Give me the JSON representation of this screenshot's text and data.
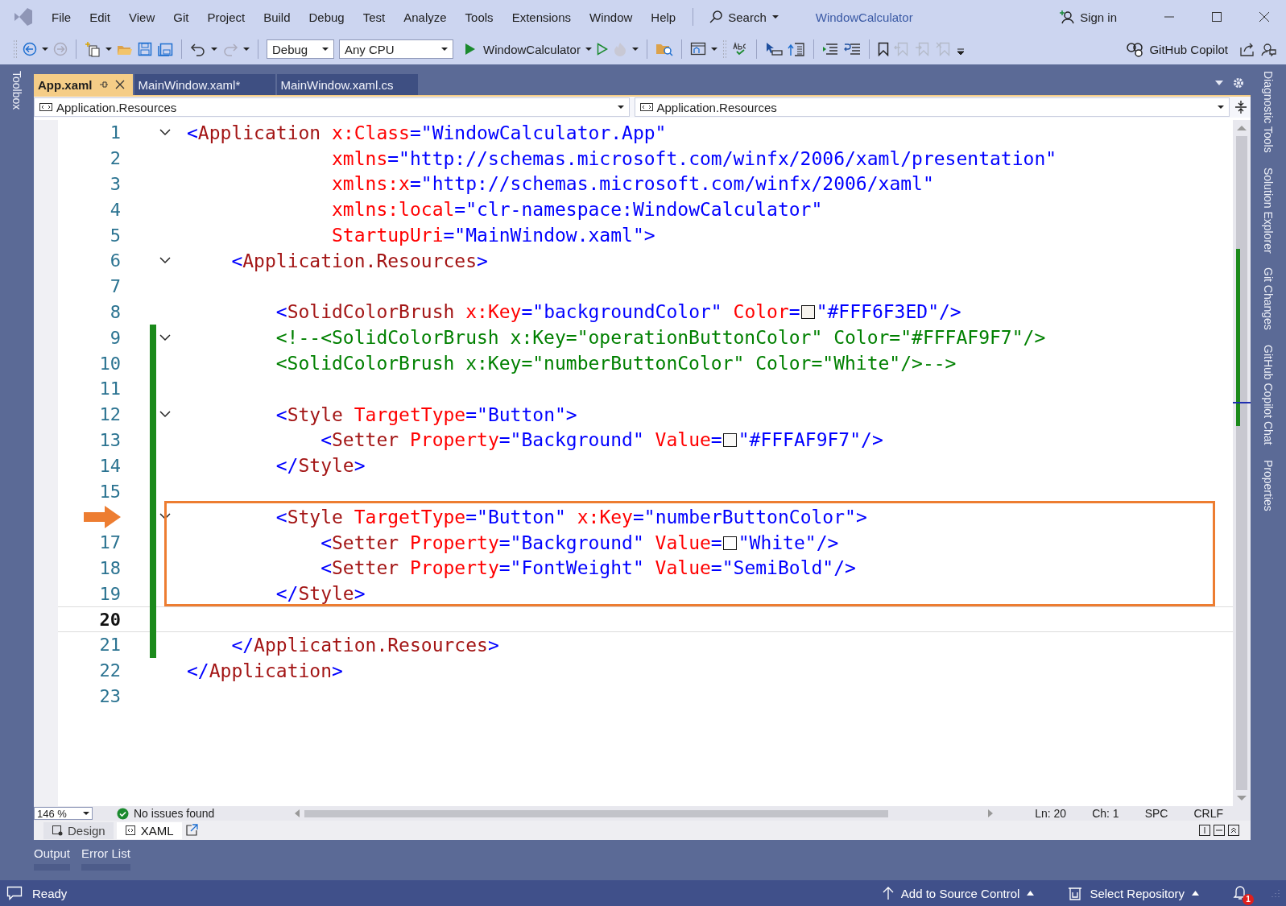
{
  "window": {
    "title": "WindowCalculator"
  },
  "menu": [
    "File",
    "Edit",
    "View",
    "Git",
    "Project",
    "Build",
    "Debug",
    "Test",
    "Analyze",
    "Tools",
    "Extensions",
    "Window",
    "Help"
  ],
  "search": {
    "label": "Search"
  },
  "account": {
    "label": "Sign in"
  },
  "toolbar": {
    "configuration": "Debug",
    "platform": "Any CPU",
    "start_target": "WindowCalculator",
    "copilot": "GitHub Copilot"
  },
  "left_rail": [
    "Toolbox"
  ],
  "right_rail": [
    "Diagnostic Tools",
    "Solution Explorer",
    "Git Changes",
    "GitHub Copilot Chat",
    "Properties"
  ],
  "tabs": [
    {
      "label": "App.xaml",
      "selected": true
    },
    {
      "label": "MainWindow.xaml*",
      "selected": false
    },
    {
      "label": "MainWindow.xaml.cs",
      "selected": false
    }
  ],
  "nav_bar": [
    "Application.Resources",
    "Application.Resources"
  ],
  "code": {
    "lines": [
      {
        "kind": "line",
        "number": "1",
        "fold": true,
        "changed": false,
        "current": false,
        "tokens": [
          {
            "kind": "punct",
            "text": "<"
          },
          {
            "kind": "element",
            "text": "Application"
          },
          {
            "kind": "attr",
            "text": " x:Class"
          },
          {
            "kind": "punct",
            "text": "="
          },
          {
            "kind": "value",
            "text": "\"WindowCalculator.App\""
          }
        ]
      },
      {
        "kind": "line",
        "number": "2",
        "fold": false,
        "changed": false,
        "current": false,
        "tokens": [
          {
            "kind": "attr",
            "text": "             xmlns"
          },
          {
            "kind": "punct",
            "text": "="
          },
          {
            "kind": "value",
            "text": "\"http://schemas.microsoft.com/winfx/2006/xaml/presentation\""
          }
        ]
      },
      {
        "kind": "line",
        "number": "3",
        "fold": false,
        "changed": false,
        "current": false,
        "tokens": [
          {
            "kind": "attr",
            "text": "             xmlns:x"
          },
          {
            "kind": "punct",
            "text": "="
          },
          {
            "kind": "value",
            "text": "\"http://schemas.microsoft.com/winfx/2006/xaml\""
          }
        ]
      },
      {
        "kind": "line",
        "number": "4",
        "fold": false,
        "changed": false,
        "current": false,
        "tokens": [
          {
            "kind": "attr",
            "text": "             xmlns:local"
          },
          {
            "kind": "punct",
            "text": "="
          },
          {
            "kind": "value",
            "text": "\"clr-namespace:WindowCalculator\""
          }
        ]
      },
      {
        "kind": "line",
        "number": "5",
        "fold": false,
        "changed": false,
        "current": false,
        "tokens": [
          {
            "kind": "attr",
            "text": "             StartupUri"
          },
          {
            "kind": "punct",
            "text": "="
          },
          {
            "kind": "value",
            "text": "\"MainWindow.xaml\""
          },
          {
            "kind": "punct",
            "text": ">"
          }
        ]
      },
      {
        "kind": "line",
        "number": "6",
        "fold": true,
        "changed": false,
        "current": false,
        "tokens": [
          {
            "kind": "punct",
            "text": "    <"
          },
          {
            "kind": "element",
            "text": "Application.Resources"
          },
          {
            "kind": "punct",
            "text": ">"
          }
        ]
      },
      {
        "kind": "line",
        "number": "7",
        "fold": false,
        "changed": false,
        "current": false
      },
      {
        "kind": "line",
        "number": "8",
        "fold": false,
        "changed": false,
        "current": false,
        "tokens": [
          {
            "kind": "punct",
            "text": "        <"
          },
          {
            "kind": "element",
            "text": "SolidColorBrush"
          },
          {
            "kind": "attr",
            "text": " x:Key"
          },
          {
            "kind": "punct",
            "text": "="
          },
          {
            "kind": "value",
            "text": "\"backgroundColor\""
          },
          {
            "kind": "attr",
            "text": " Color"
          },
          {
            "kind": "punct",
            "text": "="
          },
          {
            "kind": "swatch",
            "color": "#f6f3ed"
          },
          {
            "kind": "value",
            "text": "\"#FFF6F3ED\""
          },
          {
            "kind": "punct",
            "text": "/>"
          }
        ]
      },
      {
        "kind": "line",
        "number": "9",
        "fold": true,
        "changed": true,
        "current": false,
        "tokens": [
          {
            "kind": "comment",
            "text": "        <!--<SolidColorBrush x:Key=\"operationButtonColor\" Color=\"#FFFAF9F7\"/>"
          }
        ]
      },
      {
        "kind": "line",
        "number": "10",
        "fold": false,
        "changed": true,
        "current": false,
        "tokens": [
          {
            "kind": "comment",
            "text": "        <SolidColorBrush x:Key=\"numberButtonColor\" Color=\"White\"/>-->"
          }
        ]
      },
      {
        "kind": "line",
        "number": "11",
        "fold": false,
        "changed": true,
        "current": false
      },
      {
        "kind": "line",
        "number": "12",
        "fold": true,
        "changed": true,
        "current": false,
        "tokens": [
          {
            "kind": "punct",
            "text": "        <"
          },
          {
            "kind": "element",
            "text": "Style"
          },
          {
            "kind": "attr",
            "text": " TargetType"
          },
          {
            "kind": "punct",
            "text": "="
          },
          {
            "kind": "value",
            "text": "\"Button\""
          },
          {
            "kind": "punct",
            "text": ">"
          }
        ]
      },
      {
        "kind": "line",
        "number": "13",
        "fold": false,
        "changed": true,
        "current": false,
        "tokens": [
          {
            "kind": "punct",
            "text": "            <"
          },
          {
            "kind": "element",
            "text": "Setter"
          },
          {
            "kind": "attr",
            "text": " Property"
          },
          {
            "kind": "punct",
            "text": "="
          },
          {
            "kind": "value",
            "text": "\"Background\""
          },
          {
            "kind": "attr",
            "text": " Value"
          },
          {
            "kind": "punct",
            "text": "="
          },
          {
            "kind": "swatch",
            "color": "#faf9f7"
          },
          {
            "kind": "value",
            "text": "\"#FFFAF9F7\""
          },
          {
            "kind": "punct",
            "text": "/>"
          }
        ]
      },
      {
        "kind": "line",
        "number": "14",
        "fold": false,
        "changed": true,
        "current": false,
        "tokens": [
          {
            "kind": "punct",
            "text": "        </"
          },
          {
            "kind": "element",
            "text": "Style"
          },
          {
            "kind": "punct",
            "text": ">"
          }
        ]
      },
      {
        "kind": "line",
        "number": "15",
        "fold": false,
        "changed": true,
        "current": false
      },
      {
        "kind": "highlight",
        "lines": [
          {
            "kind": "line",
            "arrow": true,
            "fold": true,
            "changed": true,
            "current": false,
            "tokens": [
              {
                "kind": "punct",
                "text": "        <"
              },
              {
                "kind": "element",
                "text": "Style"
              },
              {
                "kind": "attr",
                "text": " TargetType"
              },
              {
                "kind": "punct",
                "text": "="
              },
              {
                "kind": "value",
                "text": "\"Button\""
              },
              {
                "kind": "attr",
                "text": " x:Key"
              },
              {
                "kind": "punct",
                "text": "="
              },
              {
                "kind": "value",
                "text": "\"numberButtonColor\""
              },
              {
                "kind": "punct",
                "text": ">"
              }
            ]
          },
          {
            "kind": "line",
            "number": "17",
            "fold": false,
            "changed": true,
            "current": false,
            "tokens": [
              {
                "kind": "punct",
                "text": "            <"
              },
              {
                "kind": "element",
                "text": "Setter"
              },
              {
                "kind": "attr",
                "text": " Property"
              },
              {
                "kind": "punct",
                "text": "="
              },
              {
                "kind": "value",
                "text": "\"Background\""
              },
              {
                "kind": "attr",
                "text": " Value"
              },
              {
                "kind": "punct",
                "text": "="
              },
              {
                "kind": "swatch",
                "color": "#ffffff"
              },
              {
                "kind": "value",
                "text": "\"White\""
              },
              {
                "kind": "punct",
                "text": "/>"
              }
            ]
          },
          {
            "kind": "line",
            "number": "18",
            "fold": false,
            "changed": true,
            "current": false,
            "tokens": [
              {
                "kind": "punct",
                "text": "            <"
              },
              {
                "kind": "element",
                "text": "Setter"
              },
              {
                "kind": "attr",
                "text": " Property"
              },
              {
                "kind": "punct",
                "text": "="
              },
              {
                "kind": "value",
                "text": "\"FontWeight\""
              },
              {
                "kind": "attr",
                "text": " Value"
              },
              {
                "kind": "punct",
                "text": "="
              },
              {
                "kind": "value",
                "text": "\"SemiBold\""
              },
              {
                "kind": "punct",
                "text": "/>"
              }
            ]
          },
          {
            "kind": "line",
            "number": "19",
            "fold": false,
            "changed": true,
            "current": false,
            "tokens": [
              {
                "kind": "punct",
                "text": "        </"
              },
              {
                "kind": "element",
                "text": "Style"
              },
              {
                "kind": "punct",
                "text": ">"
              }
            ]
          }
        ]
      },
      {
        "kind": "line",
        "number": "20",
        "fold": false,
        "changed": true,
        "current": true
      },
      {
        "kind": "line",
        "number": "21",
        "fold": false,
        "changed": true,
        "current": false,
        "tokens": [
          {
            "kind": "punct",
            "text": "    </"
          },
          {
            "kind": "element",
            "text": "Application.Resources"
          },
          {
            "kind": "punct",
            "text": ">"
          }
        ]
      },
      {
        "kind": "line",
        "number": "22",
        "fold": false,
        "changed": false,
        "current": false,
        "tokens": [
          {
            "kind": "punct",
            "text": "</"
          },
          {
            "kind": "element",
            "text": "Application"
          },
          {
            "kind": "punct",
            "text": ">"
          }
        ]
      },
      {
        "kind": "line",
        "number": "23",
        "fold": false,
        "changed": false,
        "current": false
      }
    ]
  },
  "editor_status": {
    "zoom": "146 %",
    "issues": "No issues found",
    "line": "Ln: 20",
    "column": "Ch: 1",
    "indent": "SPC",
    "line_ending": "CRLF"
  },
  "view_tabs": [
    {
      "label": "Design",
      "selected": false
    },
    {
      "label": "XAML",
      "selected": true
    }
  ],
  "panel_tabs": [
    "Output",
    "Error List"
  ],
  "status_bar": {
    "message": "Ready",
    "source_control": "Add to Source Control",
    "repository": "Select Repository",
    "notifications": "1"
  }
}
